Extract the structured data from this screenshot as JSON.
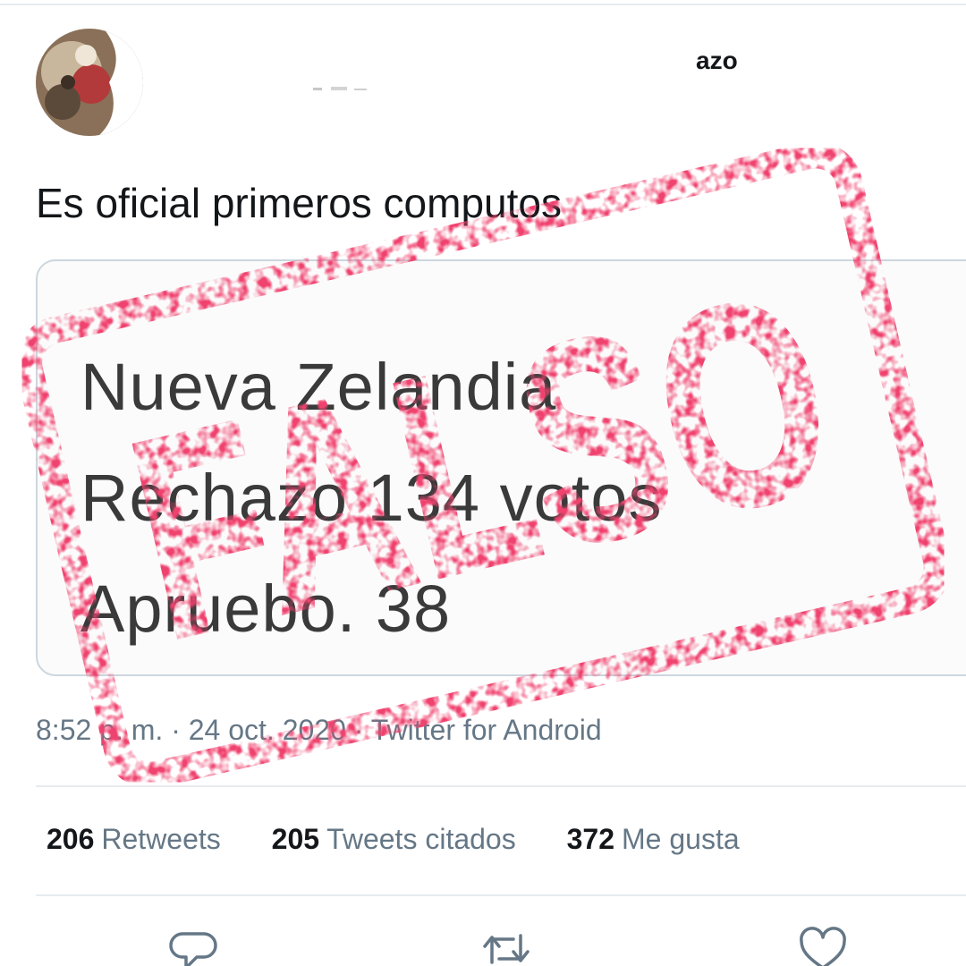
{
  "tweet": {
    "username_suffix": "azo",
    "text": "Es oficial primeros computos",
    "media_lines": [
      "Nueva Zelandia",
      "Rechazo 134 votos",
      "Apruebo. 38"
    ],
    "timestamp_source": "8:52 p. m. · 24 oct. 2020 · Twitter for Android",
    "stats": {
      "retweets_count": "206",
      "retweets_label": "Retweets",
      "quotes_count": "205",
      "quotes_label": "Tweets citados",
      "likes_count": "372",
      "likes_label": "Me gusta"
    }
  },
  "stamp": {
    "text": "FALSO",
    "color": "#f0426e"
  },
  "icons": {
    "reply": "reply-icon",
    "retweet": "retweet-icon",
    "like": "heart-icon"
  }
}
